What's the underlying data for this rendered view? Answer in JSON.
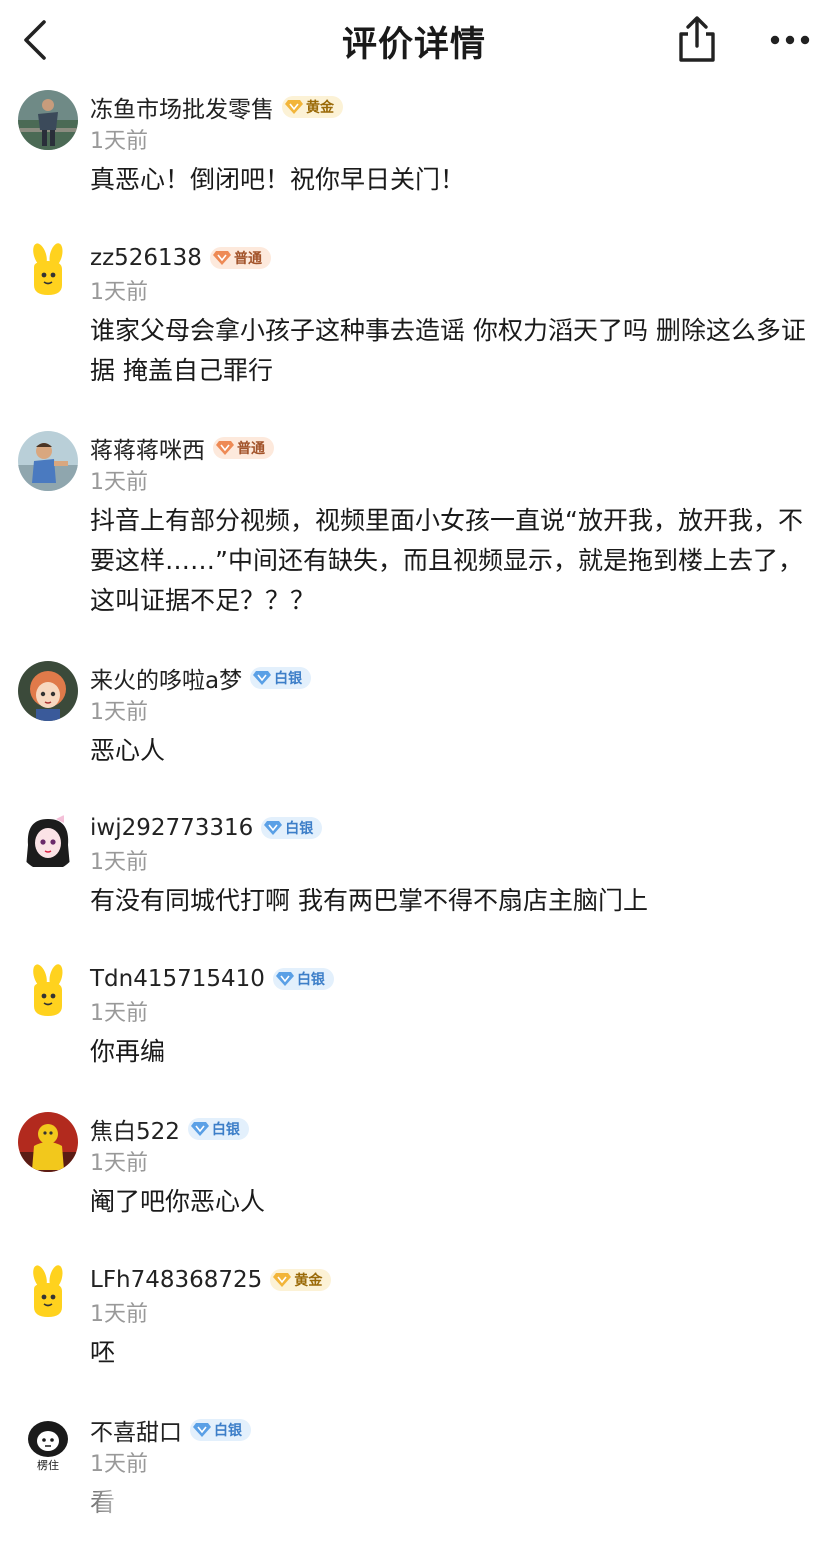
{
  "header": {
    "title": "评价详情",
    "back_icon": "chevron-left-icon",
    "share_icon": "share-icon",
    "more_icon": "more-dots-icon"
  },
  "colors": {
    "gold_badge": "#fcf2d6",
    "normal_badge": "#fde9dc",
    "silver_badge": "#e3f0fc",
    "time_text": "#999999"
  },
  "comments": [
    {
      "username": "冻鱼市场批发零售",
      "badge": "黄金",
      "badge_type": "gold",
      "time": "1天前",
      "text": "真恶心！倒闭吧！祝你早日关门！",
      "avatar": "photo-person-avatar"
    },
    {
      "username": "zz526138",
      "badge": "普通",
      "badge_type": "normal",
      "time": "1天前",
      "text": "谁家父母会拿小孩子这种事去造谣 你权力滔天了吗 删除这么多证据 掩盖自己罪行",
      "avatar": "yellow-hand-avatar"
    },
    {
      "username": "蒋蒋蒋咪西",
      "badge": "普通",
      "badge_type": "normal",
      "time": "1天前",
      "text": "抖音上有部分视频，视频里面小女孩一直说“放开我，放开我，不要这样……”中间还有缺失，而且视频显示，就是拖到楼上去了，这叫证据不足？？？",
      "avatar": "photo-child-avatar"
    },
    {
      "username": "来火的哆啦a梦",
      "badge": "白银",
      "badge_type": "silver",
      "time": "1天前",
      "text": "恶心人",
      "avatar": "anime-girl-avatar"
    },
    {
      "username": "iwj292773316",
      "badge": "白银",
      "badge_type": "silver",
      "time": "1天前",
      "text": "有没有同城代打啊 我有两巴掌不得不扇店主脑门上",
      "avatar": "cartoon-girl-avatar"
    },
    {
      "username": "Tdn415715410",
      "badge": "白银",
      "badge_type": "silver",
      "time": "1天前",
      "text": "你再编",
      "avatar": "yellow-hand-avatar"
    },
    {
      "username": "焦白522",
      "badge": "白银",
      "badge_type": "silver",
      "time": "1天前",
      "text": "阉了吧你恶心人",
      "avatar": "yellow-figure-avatar"
    },
    {
      "username": "LFh748368725",
      "badge": "黄金",
      "badge_type": "gold",
      "time": "1天前",
      "text": "呸",
      "avatar": "yellow-hand-avatar"
    },
    {
      "username": "不喜甜口",
      "badge": "白银",
      "badge_type": "silver",
      "time": "1天前",
      "text": "看",
      "avatar": "meme-face-avatar",
      "avatar_caption": "楞住"
    }
  ]
}
